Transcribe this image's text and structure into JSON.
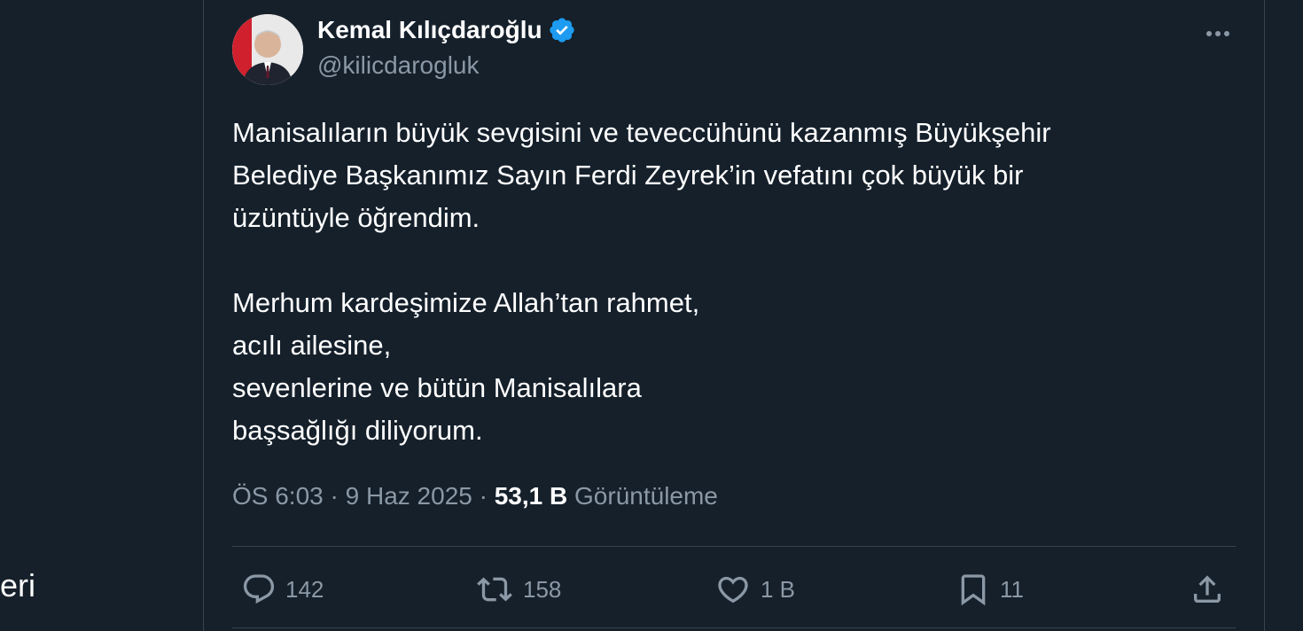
{
  "left_nav": {
    "partial_label": "eri"
  },
  "tweet": {
    "author_name": "Kemal Kılıçdaroğlu",
    "author_handle": "@kilicdarogluk",
    "paragraph1": {
      "line1": "Manisalıların büyük sevgisini ve teveccühünü kazanmış Büyükşehir",
      "line2": "Belediye Başkanımız Sayın Ferdi Zeyrek’in vefatını çok büyük bir",
      "line3": "üzüntüyle öğrendim."
    },
    "paragraph2": {
      "line1": "Merhum kardeşimize Allah’tan rahmet,",
      "line2": "acılı ailesine,",
      "line3": "sevenlerine ve bütün Manisalılara",
      "line4": "başsağlığı diliyorum."
    },
    "time": "ÖS 6:03",
    "date": "9 Haz 2025",
    "views_count": "53,1 B",
    "views_label": "Görüntüleme"
  },
  "actions": {
    "replies": "142",
    "reposts": "158",
    "likes": "1 B",
    "bookmarks": "11"
  },
  "icons": {
    "verified": "verified-badge-icon",
    "more": "more-icon",
    "reply": "reply-icon",
    "repost": "repost-icon",
    "like": "like-icon",
    "bookmark": "bookmark-icon",
    "share": "share-icon"
  },
  "colors": {
    "background": "#15202b",
    "verified_blue": "#1d9bf0",
    "secondary_text": "#8b98a5",
    "divider": "#38444d"
  }
}
